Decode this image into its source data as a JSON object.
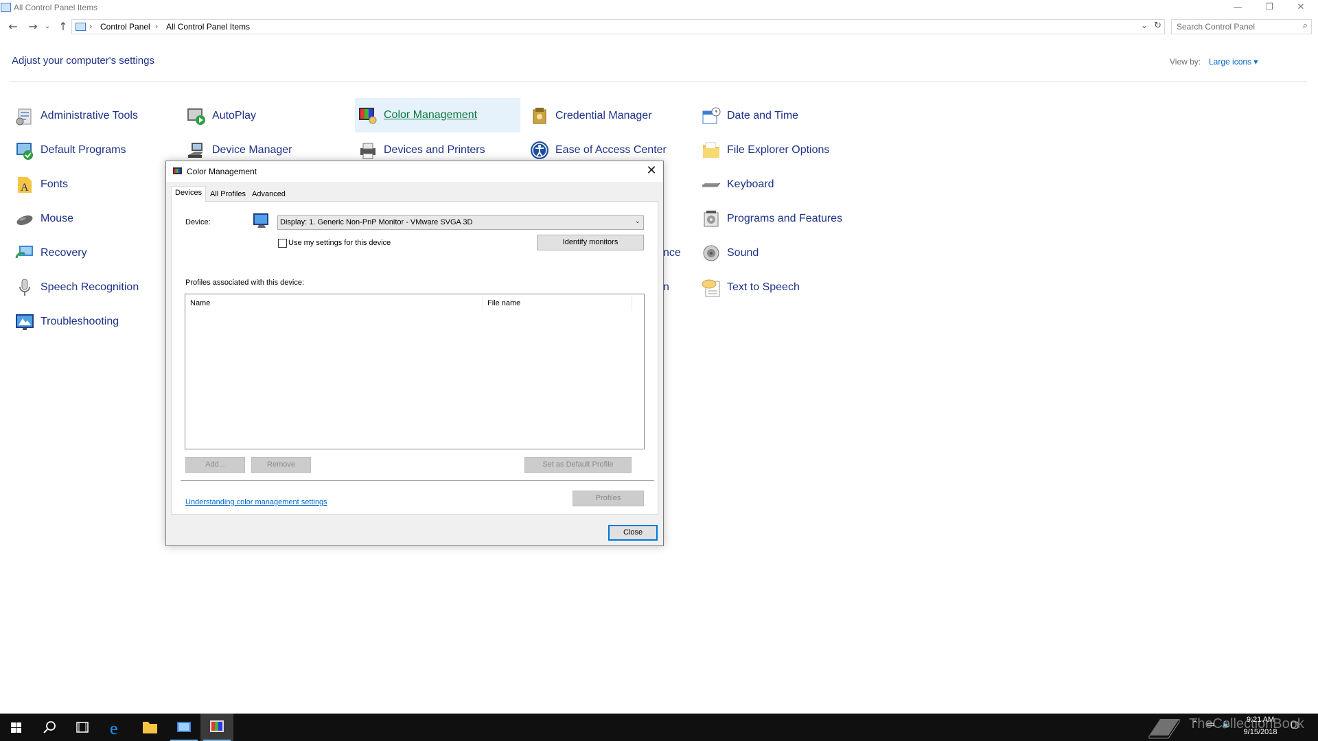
{
  "window": {
    "title": "All Control Panel Items",
    "minimize_glyph": "—",
    "restore_glyph": "❐",
    "close_glyph": "✕"
  },
  "address": {
    "crumbs": [
      "Control Panel",
      "All Control Panel Items"
    ],
    "search_placeholder": "Search Control Panel"
  },
  "header": {
    "title": "Adjust your computer's settings",
    "view_by_label": "View by:",
    "view_by_value": "Large icons ▾"
  },
  "items": [
    {
      "label": "Administrative Tools",
      "icon": "administrative-tools-icon"
    },
    {
      "label": "AutoPlay",
      "icon": "autoplay-icon"
    },
    {
      "label": "Color Management",
      "icon": "color-management-icon"
    },
    {
      "label": "Credential Manager",
      "icon": "credential-manager-icon"
    },
    {
      "label": "Date and Time",
      "icon": "date-time-icon"
    },
    {
      "label": "Default Programs",
      "icon": "default-programs-icon"
    },
    {
      "label": "Device Manager",
      "icon": "device-manager-icon"
    },
    {
      "label": "Devices and Printers",
      "icon": "devices-printers-icon"
    },
    {
      "label": "Ease of Access Center",
      "icon": "ease-of-access-icon"
    },
    {
      "label": "File Explorer Options",
      "icon": "folder-options-icon"
    },
    {
      "label": "Fonts",
      "icon": "fonts-icon"
    },
    {
      "label": "Keyboard",
      "icon": "keyboard-icon"
    },
    {
      "label": "Mouse",
      "icon": "mouse-icon"
    },
    {
      "label": "Programs and Features",
      "icon": "programs-features-icon"
    },
    {
      "label": "Recovery",
      "icon": "recovery-icon"
    },
    {
      "label": "nce",
      "icon": ""
    },
    {
      "label": "Sound",
      "icon": "sound-icon"
    },
    {
      "label": "Speech Recognition",
      "icon": "microphone-icon"
    },
    {
      "label": "n",
      "icon": ""
    },
    {
      "label": "Text to Speech",
      "icon": "text-to-speech-icon"
    },
    {
      "label": "Troubleshooting",
      "icon": "troubleshooting-icon"
    }
  ],
  "dialog": {
    "title": "Color Management",
    "tabs": [
      "Devices",
      "All Profiles",
      "Advanced"
    ],
    "device_label": "Device:",
    "device_value": "Display: 1. Generic Non-PnP Monitor - VMware SVGA 3D",
    "use_settings_label": "Use my settings for this device",
    "use_settings_checked": false,
    "identify_button": "Identify monitors",
    "profiles_label": "Profiles associated with this device:",
    "columns": [
      "Name",
      "File name"
    ],
    "profiles": [],
    "add_button": "Add...",
    "remove_button": "Remove",
    "set_default_button": "Set as Default Profile",
    "profiles_button": "Profiles",
    "help_link": "Understanding color management settings",
    "close_button": "Close"
  },
  "taskbar": {
    "time": "9:21 AM",
    "date": "9/15/2018",
    "watermark": "TheCollectionBook"
  }
}
